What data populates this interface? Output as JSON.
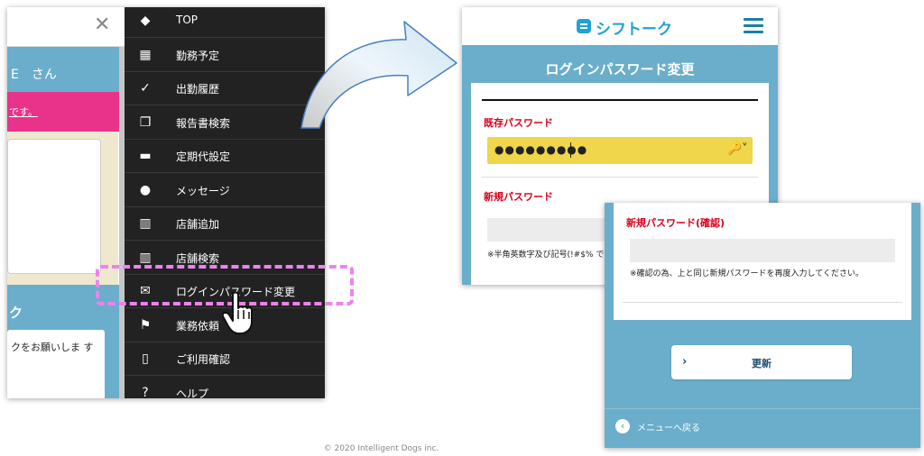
{
  "left_panel": {
    "user_name_suffix": "E　さん",
    "banner_text": "です。",
    "section_heading": "ク",
    "card_text": "クをお願いしま す",
    "close_glyph": "✕"
  },
  "menu": {
    "items": [
      {
        "label": "TOP",
        "icon": "tag-icon",
        "glyph": "◆"
      },
      {
        "label": "勤務予定",
        "icon": "calendar-icon",
        "glyph": "▦"
      },
      {
        "label": "出勤履歴",
        "icon": "check-circle-icon",
        "glyph": "✓"
      },
      {
        "label": "報告書検索",
        "icon": "copy-icon",
        "glyph": "❐"
      },
      {
        "label": "定期代設定",
        "icon": "card-icon",
        "glyph": "▬"
      },
      {
        "label": "メッセージ",
        "icon": "chat-icon",
        "glyph": "●"
      },
      {
        "label": "店舗追加",
        "icon": "store-icon",
        "glyph": "▥"
      },
      {
        "label": "店舗検索",
        "icon": "store-icon",
        "glyph": "▥"
      },
      {
        "label": "ログインパスワード変更",
        "icon": "mail-icon",
        "glyph": "✉"
      },
      {
        "label": "業務依頼",
        "icon": "flag-icon",
        "glyph": "⚑"
      },
      {
        "label": "ご利用確認",
        "icon": "document-icon",
        "glyph": "▯"
      },
      {
        "label": "ヘルプ",
        "icon": "help-icon",
        "glyph": "?"
      }
    ]
  },
  "password_page": {
    "logo_text": "シフトーク",
    "title": "ログインパスワード変更",
    "current_label": "既存パスワード",
    "current_value": "●●●●●●●●●",
    "key_glyph": "🔑˅",
    "new_label": "新規パスワード",
    "new_note": "※半角英数字及び記号(!#$% できます。"
  },
  "confirm_page": {
    "confirm_label": "新規パスワード(確認)",
    "confirm_note": "※確認の為、上と同じ新規パスワードを再度入力してください。",
    "update_label": "更新",
    "update_chevron": "›",
    "back_label": "メニューへ戻る",
    "back_glyph": "‹"
  },
  "colors": {
    "header_blue": "#6aaecb",
    "menu_bg": "#222222",
    "pink": "#e9338a",
    "highlight_dash": "#ee82ee",
    "yellow_input": "#efd64a",
    "red_label": "#d9001b",
    "logo_blue": "#1fa2d4"
  },
  "footer": {
    "copyright": "© 2020 Intelligent Dogs inc."
  }
}
